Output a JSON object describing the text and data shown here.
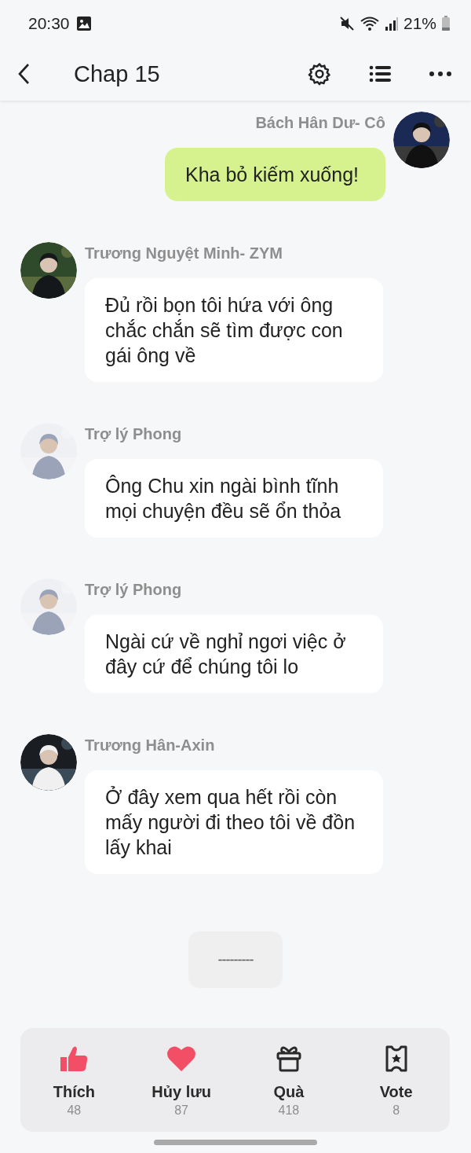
{
  "status_bar": {
    "time": "20:30",
    "battery": "21%"
  },
  "header": {
    "title": "Chap 15"
  },
  "messages": [
    {
      "kind": "sent",
      "sender": "Bách Hân Dư- Cô",
      "text": "Kha bỏ kiếm xuống!"
    },
    {
      "kind": "received",
      "sender": "Trương Nguyệt Minh- ZYM",
      "text": "Đủ rồi bọn tôi hứa với ông chắc chắn sẽ tìm được con gái ông về"
    },
    {
      "kind": "received",
      "sender": "Trợ lý Phong",
      "text": "Ông Chu xin ngài bình tĩnh mọi chuyện đều sẽ ổn thỏa"
    },
    {
      "kind": "received",
      "sender": "Trợ lý Phong",
      "text": "Ngài cứ về nghỉ ngơi việc ở đây cứ để chúng tôi lo"
    },
    {
      "kind": "received",
      "sender": "Trương Hân-Axin",
      "text": "Ở đây xem qua hết rồi còn mấy người đi theo tôi về đồn lấy khai"
    }
  ],
  "separator": {
    "text": "---------"
  },
  "actions": [
    {
      "kind": "like",
      "label": "Thích",
      "count": "48",
      "active": true
    },
    {
      "kind": "save",
      "label": "Hủy lưu",
      "count": "87",
      "active": true
    },
    {
      "kind": "gift",
      "label": "Quà",
      "count": "418",
      "active": false
    },
    {
      "kind": "vote",
      "label": "Vote",
      "count": "8",
      "active": false
    }
  ]
}
